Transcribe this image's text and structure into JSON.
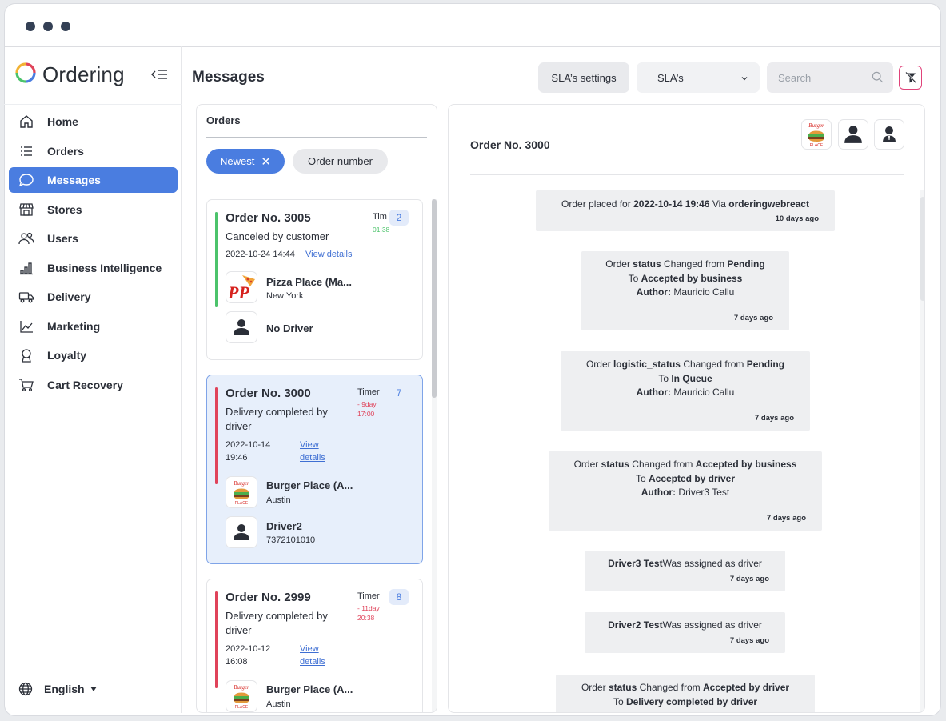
{
  "app": {
    "brand": "Ordering"
  },
  "sidebar": {
    "items": [
      {
        "label": "Home",
        "icon": "home-icon"
      },
      {
        "label": "Orders",
        "icon": "list-icon"
      },
      {
        "label": "Messages",
        "icon": "chat-icon"
      },
      {
        "label": "Stores",
        "icon": "store-icon"
      },
      {
        "label": "Users",
        "icon": "users-icon"
      },
      {
        "label": "Business Intelligence",
        "icon": "bar-chart-icon"
      },
      {
        "label": "Delivery",
        "icon": "truck-icon"
      },
      {
        "label": "Marketing",
        "icon": "trend-icon"
      },
      {
        "label": "Loyalty",
        "icon": "medal-icon"
      },
      {
        "label": "Cart Recovery",
        "icon": "cart-icon"
      }
    ],
    "language": "English"
  },
  "header": {
    "title": "Messages",
    "sla_settings_label": "SLA’s settings",
    "sla_select_value": "SLA’s",
    "search_placeholder": "Search"
  },
  "orders_panel": {
    "tab": "Orders",
    "chip_newest": "Newest",
    "chip_order_number": "Order number",
    "cards": [
      {
        "title": "Order No. 3005",
        "status": "Canceled by customer",
        "date": "2022-10-24 14:44",
        "link": "View details",
        "timer_label": "Tim",
        "timer_value": "01:38",
        "badge": "2",
        "business_name": "Pizza Place (Ma...",
        "business_city": "New York",
        "driver_name": "No Driver",
        "driver_phone": ""
      },
      {
        "title": "Order No. 3000",
        "status_line1": "Delivery completed by",
        "status_line2": "driver",
        "date_line1": "2022-10-14",
        "date_line2": "19:46",
        "link_line1": "View",
        "link_line2": "details",
        "timer_label": "Timer",
        "timer_line1": "- 9day",
        "timer_line2": "17:00",
        "badge": "7",
        "business_name": "Burger Place (A...",
        "business_city": "Austin",
        "driver_name": "Driver2",
        "driver_phone": "7372101010"
      },
      {
        "title": "Order No. 2999",
        "status_line1": "Delivery completed by",
        "status_line2": "driver",
        "date_line1": "2022-10-12",
        "date_line2": "16:08",
        "link_line1": "View",
        "link_line2": "details",
        "timer_label": "Timer",
        "timer_line1": "- 11day",
        "timer_line2": "20:38",
        "badge": "8",
        "business_name": "Burger Place (A...",
        "business_city": "Austin"
      }
    ]
  },
  "detail": {
    "title": "Order No. 3000",
    "logo_text": "Burger Place",
    "messages": {
      "m1": {
        "a": "Order placed for ",
        "b": "2022-10-14 19:46",
        "c": " Via ",
        "d": "orderingwebreact",
        "ago": "10 days ago"
      },
      "m2": {
        "a": "Order ",
        "b": "status",
        "c": " Changed from ",
        "d": "Pending",
        "e": "To ",
        "f": "Accepted by business",
        "g": "Author:",
        "h": " Mauricio Callu",
        "ago": "7 days ago"
      },
      "m3": {
        "a": "Order ",
        "b": "logistic_status",
        "c": " Changed from ",
        "d": "Pending",
        "e": "To ",
        "f": "In Queue",
        "g": "Author:",
        "h": " Mauricio Callu",
        "ago": "7 days ago"
      },
      "m4": {
        "a": "Order ",
        "b": "status",
        "c": " Changed from ",
        "d": "Accepted by business",
        "e": "To ",
        "f": "Accepted by driver",
        "g": "Author:",
        "h": " Driver3 Test",
        "ago": "7 days ago"
      },
      "m5": {
        "b": "Driver3 Test",
        "c": "Was assigned as driver",
        "ago": "7 days ago"
      },
      "m6": {
        "b": "Driver2 Test",
        "c": "Was assigned as driver",
        "ago": "7 days ago"
      },
      "m7": {
        "a": "Order ",
        "b": "status",
        "c": " Changed from ",
        "d": "Accepted by driver",
        "e": "To ",
        "f": "Delivery completed by driver"
      }
    }
  },
  "colors": {
    "accent": "#4a7de0",
    "green_status": "#4cc36b",
    "red_status": "#e0435a",
    "filter_border": "#e0437a"
  }
}
